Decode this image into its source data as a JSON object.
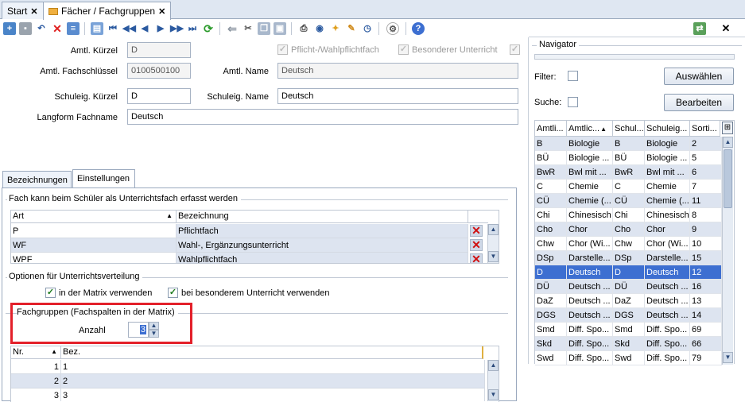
{
  "tabs": [
    {
      "label": "Start"
    },
    {
      "label": "Fächer / Fachgruppen"
    }
  ],
  "form": {
    "amtl_kuerzel_label": "Amtl. Kürzel",
    "amtl_kuerzel": "D",
    "pflicht_label": "Pflicht-/Wahlpflichtfach",
    "besonderer_label": "Besonderer Unterricht",
    "amtl_fachschluessel_label": "Amtl. Fachschlüssel",
    "amtl_fachschluessel": "0100500100",
    "amtl_name_label": "Amtl. Name",
    "amtl_name": "Deutsch",
    "schuleig_kuerzel_label": "Schuleig. Kürzel",
    "schuleig_kuerzel": "D",
    "schuleig_name_label": "Schuleig. Name",
    "schuleig_name": "Deutsch",
    "langform_label": "Langform Fachname",
    "langform": "Deutsch"
  },
  "inner_tabs": [
    {
      "label": "Bezeichnungen"
    },
    {
      "label": "Einstellungen"
    }
  ],
  "settings": {
    "group1_title": "Fach kann beim Schüler als Unterrichtsfach erfasst werden",
    "art_header": "Art",
    "bez_header": "Bezeichnung",
    "art_rows": [
      {
        "art": "P",
        "bez": "Pflichtfach"
      },
      {
        "art": "WF",
        "bez": "Wahl-, Ergänzungsunterricht"
      },
      {
        "art": "WPF",
        "bez": "Wahlpflichtfach"
      }
    ],
    "group2_title": "Optionen für Unterrichtsverteilung",
    "in_matrix_label": "in der Matrix verwenden",
    "besonderem_label": "bei besonderem Unterricht verwenden",
    "group3_title": "Fachgruppen (Fachspalten in der Matrix)",
    "anzahl_label": "Anzahl",
    "anzahl": "3",
    "nr_header": "Nr.",
    "bez2_header": "Bez.",
    "fg_rows": [
      {
        "nr": "1",
        "bez": "1"
      },
      {
        "nr": "2",
        "bez": "2"
      },
      {
        "nr": "3",
        "bez": "3"
      }
    ]
  },
  "navigator": {
    "title": "Navigator",
    "filter_label": "Filter:",
    "suche_label": "Suche:",
    "auswaehlen": "Auswählen",
    "bearbeiten": "Bearbeiten",
    "headers": [
      "Amtli...",
      "Amtlic...",
      "Schul...",
      "Schuleig...",
      "Sorti..."
    ],
    "rows": [
      [
        "B",
        "Biologie",
        "B",
        "Biologie",
        "2"
      ],
      [
        "BÜ",
        "Biologie ...",
        "BÜ",
        "Biologie ...",
        "5"
      ],
      [
        "BwR",
        "Bwl mit ...",
        "BwR",
        "Bwl mit ...",
        "6"
      ],
      [
        "C",
        "Chemie",
        "C",
        "Chemie",
        "7"
      ],
      [
        "CÜ",
        "Chemie (...",
        "CÜ",
        "Chemie (...",
        "11"
      ],
      [
        "Chi",
        "Chinesisch",
        "Chi",
        "Chinesisch",
        "8"
      ],
      [
        "Cho",
        "Chor",
        "Cho",
        "Chor",
        "9"
      ],
      [
        "Chw",
        "Chor (Wi...",
        "Chw",
        "Chor (Wi...",
        "10"
      ],
      [
        "DSp",
        "Darstelle...",
        "DSp",
        "Darstelle...",
        "15"
      ],
      [
        "D",
        "Deutsch",
        "D",
        "Deutsch",
        "12"
      ],
      [
        "DÜ",
        "Deutsch ...",
        "DÜ",
        "Deutsch ...",
        "16"
      ],
      [
        "DaZ",
        "Deutsch ...",
        "DaZ",
        "Deutsch ...",
        "13"
      ],
      [
        "DGS",
        "Deutsch ...",
        "DGS",
        "Deutsch ...",
        "14"
      ],
      [
        "Smd",
        "Diff. Spo...",
        "Smd",
        "Diff. Spo...",
        "69"
      ],
      [
        "Skd",
        "Diff. Spo...",
        "Skd",
        "Diff. Spo...",
        "66"
      ],
      [
        "Swd",
        "Diff. Spo...",
        "Swd",
        "Diff. Spo...",
        "79"
      ]
    ],
    "selected_index": 9
  },
  "colors": {
    "accent": "#3d6fd1",
    "highlight": "#e3202a",
    "selected_row": "#3d6fd1"
  }
}
